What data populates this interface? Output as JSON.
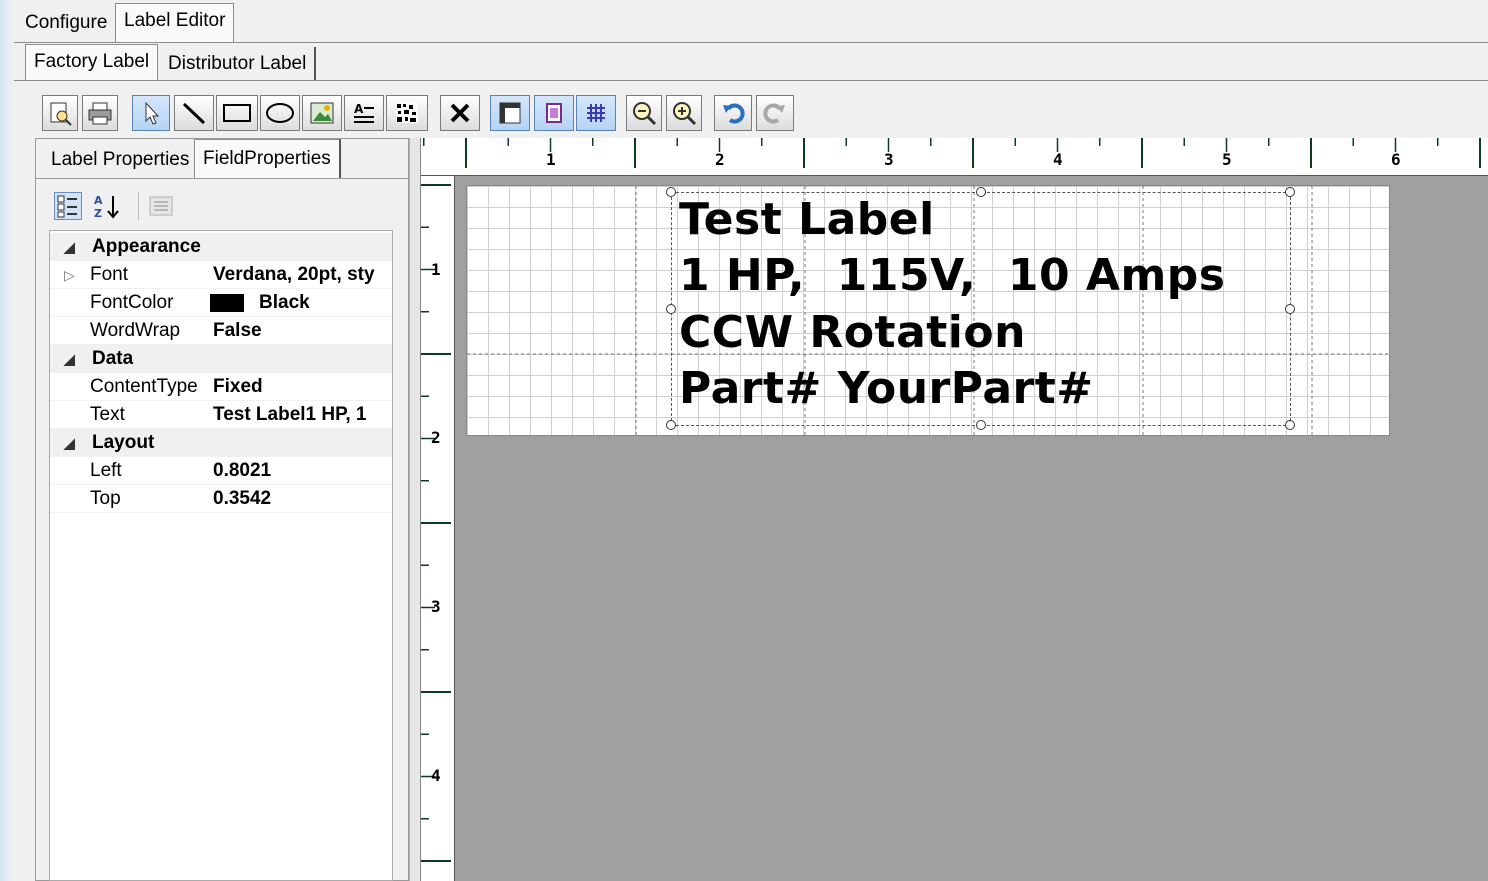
{
  "main_tabs": [
    "Configure",
    "Label Editor"
  ],
  "sub_tabs": [
    "Factory Label",
    "Distributor Label"
  ],
  "toolbar": {
    "buttons": [
      "print-preview",
      "print",
      "select-pointer",
      "draw-line",
      "draw-rectangle",
      "draw-ellipse",
      "insert-image",
      "insert-text",
      "insert-barcode",
      "delete",
      "toggle-ruler",
      "page-view",
      "toggle-grid",
      "zoom-out",
      "zoom-in",
      "undo",
      "redo"
    ]
  },
  "panel_tabs": [
    "Label Properties",
    "FieldProperties"
  ],
  "property_grid": {
    "categories": [
      {
        "name": "Appearance",
        "props": [
          {
            "name": "Font",
            "value": "Verdana, 20pt, sty"
          },
          {
            "name": "FontColor",
            "value": "Black",
            "swatch": "#000000"
          },
          {
            "name": "WordWrap",
            "value": "False"
          }
        ]
      },
      {
        "name": "Data",
        "props": [
          {
            "name": "ContentType",
            "value": "Fixed"
          },
          {
            "name": "Text",
            "value": "Test Label1 HP, 1"
          }
        ]
      },
      {
        "name": "Layout",
        "props": [
          {
            "name": "Left",
            "value": "0.8021"
          },
          {
            "name": "Top",
            "value": "0.3542"
          }
        ]
      }
    ]
  },
  "ruler": {
    "horizontal": [
      "1",
      "2",
      "3",
      "4",
      "5",
      "6"
    ],
    "vertical": [
      "1",
      "2",
      "3",
      "4"
    ]
  },
  "label": {
    "lines": [
      "Test Label",
      "1 HP,  115V,  10 Amps",
      "CCW Rotation",
      "Part# YourPart#"
    ]
  },
  "colors": {
    "canvas_bg": "#a0a0a0",
    "selected_tool": "#b5d3f4",
    "ruler_ticks": "#0b3d1e"
  }
}
